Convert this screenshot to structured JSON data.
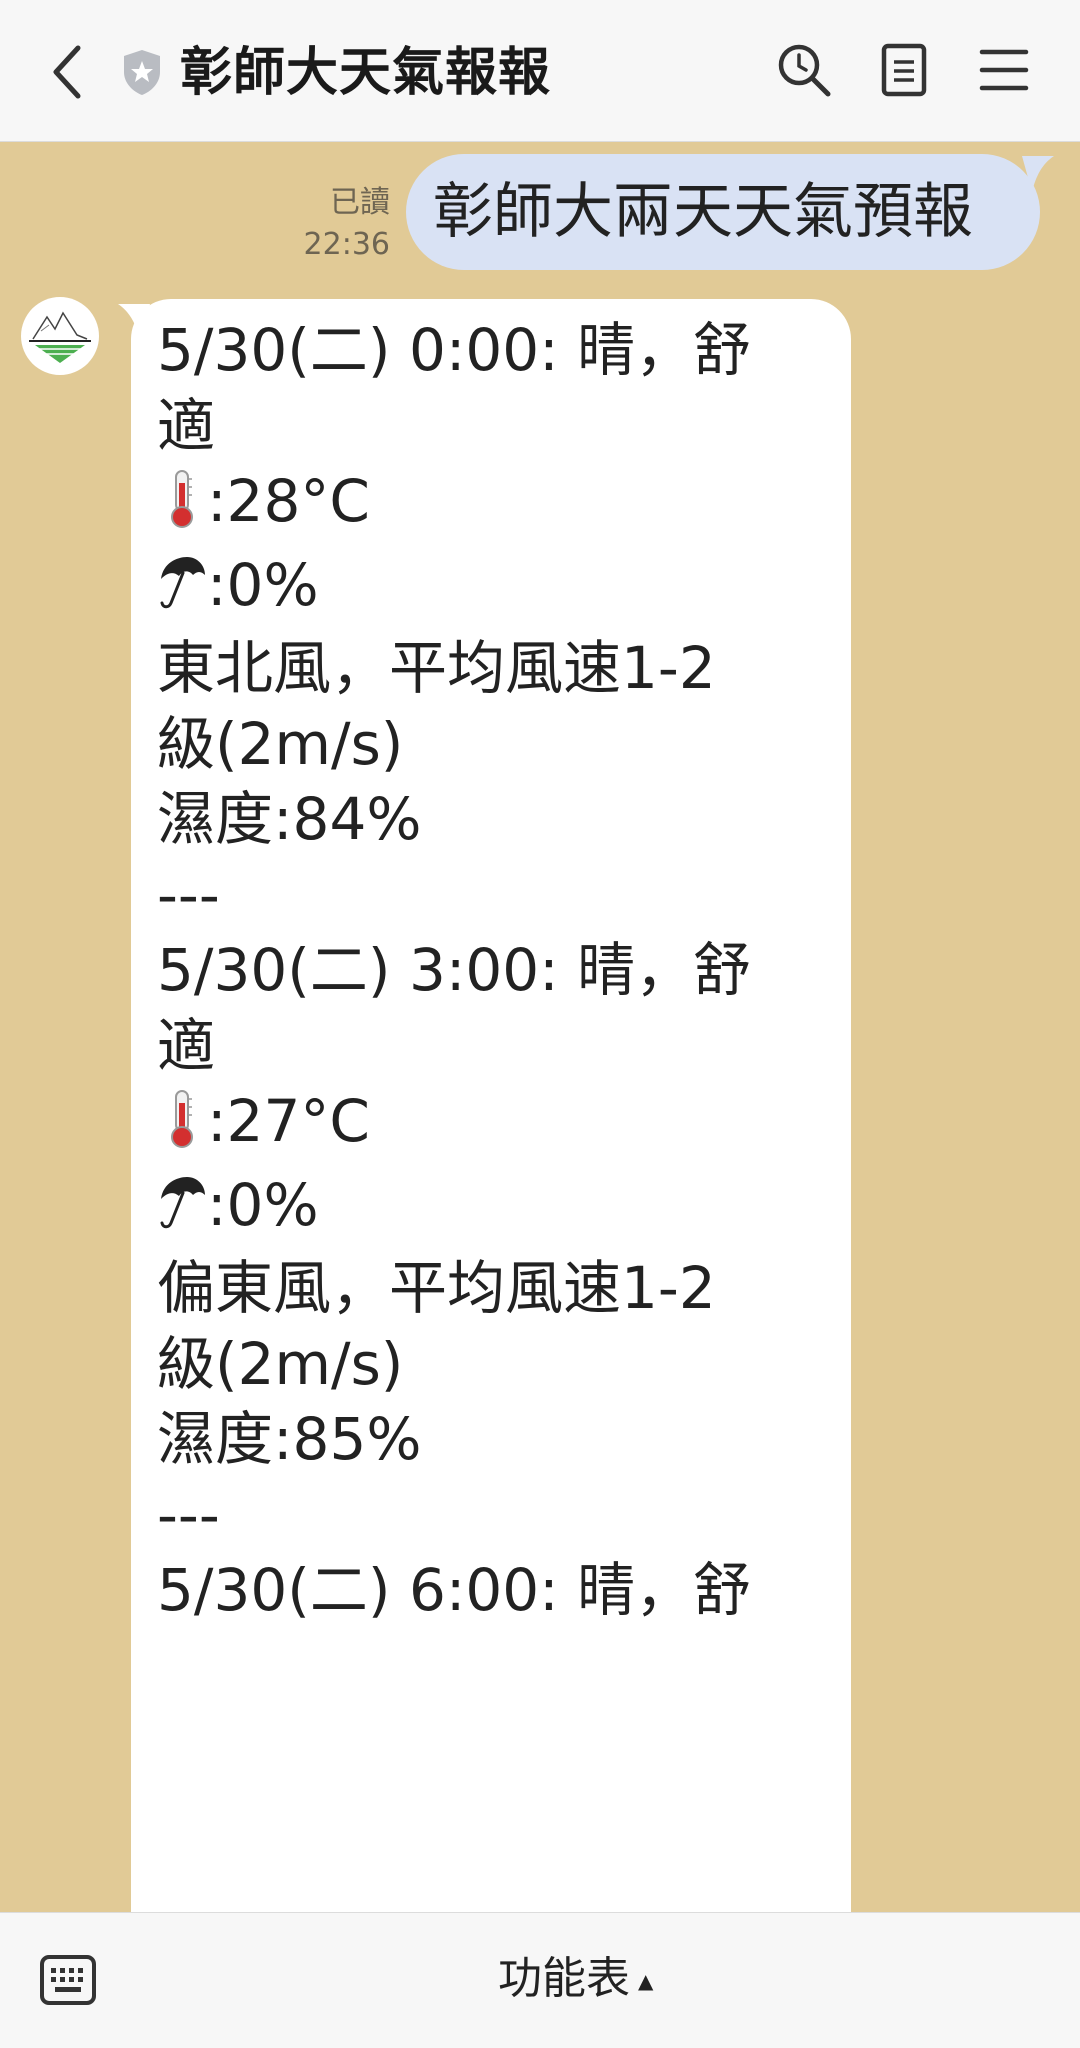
{
  "header": {
    "title": "彰師大天氣報報",
    "icons": [
      "chevron-left-icon",
      "shield-star-icon",
      "search-icon",
      "note-icon",
      "hamburger-icon"
    ]
  },
  "sent_message": {
    "text": "彰師大兩天天氣預報",
    "read_label": "已讀",
    "time": "22:36"
  },
  "bot_message": {
    "lines": [
      {
        "text": "5/30(二) 0:00: 晴，舒"
      },
      {
        "text": "適"
      },
      {
        "icon": "thermometer",
        "text": ":28°C"
      },
      {
        "icon": "umbrella",
        "text": ":0%"
      },
      {
        "text": "東北風，平均風速1-2"
      },
      {
        "text": "級(2m/s)"
      },
      {
        "text": "濕度:84%"
      },
      {
        "text": "---"
      },
      {
        "text": "5/30(二) 3:00: 晴，舒"
      },
      {
        "text": "適"
      },
      {
        "icon": "thermometer",
        "text": ":27°C"
      },
      {
        "icon": "umbrella",
        "text": ":0%"
      },
      {
        "text": "偏東風，平均風速1-2"
      },
      {
        "text": "級(2m/s)"
      },
      {
        "text": "濕度:85%"
      },
      {
        "text": "---"
      },
      {
        "text": "5/30(二) 6:00: 晴，舒"
      }
    ]
  },
  "bottom_bar": {
    "menu_label": "功能表"
  },
  "colors": {
    "chat_background": "#e1ca96",
    "my_bubble": "#d9e2f4",
    "bot_bubble": "#ffffff",
    "bars": "#f7f7f7"
  }
}
